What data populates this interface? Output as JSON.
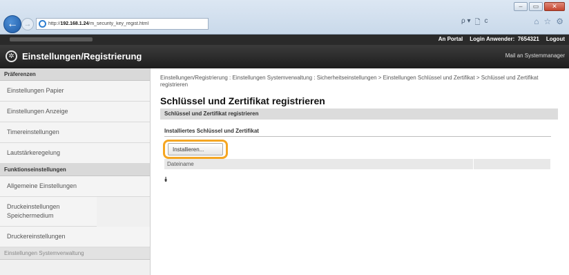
{
  "browser": {
    "url_prefix": "http://",
    "url_host": "192.168.1.24",
    "url_path": "/m_security_key_regist.html",
    "back_glyph": "←",
    "forward_glyph": "→",
    "search_glyph": "ρ",
    "tools": [
      "ρ ▾",
      "🗋",
      "c"
    ],
    "fav_icons": [
      "⌂",
      "☆",
      "⚙"
    ],
    "window_controls": [
      "–",
      "▭",
      "✕"
    ]
  },
  "topbar": {
    "portal": "An Portal",
    "login_label": "Login Anwender:",
    "user": "7654321",
    "logout": "Logout"
  },
  "header": {
    "title": "Einstellungen/Registrierung",
    "mail_link": "Mail an Systemmanager"
  },
  "sidebar": {
    "section_prefs": "Präferenzen",
    "items_prefs": [
      "Einstellungen Papier",
      "Einstellungen Anzeige",
      "Timereinstellungen",
      "Lautstärkeregelung"
    ],
    "section_functions": "Funktionseinstellungen",
    "items_functions": [
      "Allgemeine Einstellungen",
      "Druckeinstellungen Speichermedium",
      "Druckereinstellungen"
    ],
    "section_system": "Einstellungen Systemverwaltung"
  },
  "main": {
    "breadcrumb": "Einstellungen/Registrierung : Einstellungen Systemverwaltung : Sicherheitseinstellungen > Einstellungen Schlüssel und Zertifikat > Schlüssel und Zertifikat registrieren",
    "title": "Schlüssel und Zertifikat registrieren",
    "section_bar": "Schlüssel und Zertifikat registrieren",
    "sub_header": "Installiertes Schlüssel und Zertifikat",
    "install_button": "Installieren...",
    "table_header_filename": "Dateiname",
    "collapse_glyph": "⯯"
  }
}
